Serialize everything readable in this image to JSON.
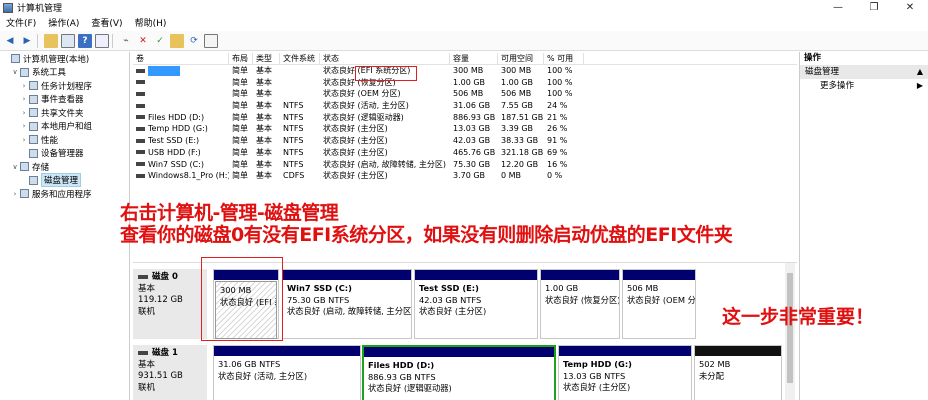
{
  "window": {
    "title": "计算机管理",
    "controls": [
      "—",
      "❐",
      "✕"
    ]
  },
  "menu": [
    "文件(F)",
    "操作(A)",
    "查看(V)",
    "帮助(H)"
  ],
  "tree": {
    "items": [
      {
        "label": "计算机管理(本地)",
        "indent": 0,
        "arrow": ""
      },
      {
        "label": "系统工具",
        "indent": 1,
        "arrow": "∨"
      },
      {
        "label": "任务计划程序",
        "indent": 2,
        "arrow": "›"
      },
      {
        "label": "事件查看器",
        "indent": 2,
        "arrow": "›"
      },
      {
        "label": "共享文件夹",
        "indent": 2,
        "arrow": "›"
      },
      {
        "label": "本地用户和组",
        "indent": 2,
        "arrow": "›"
      },
      {
        "label": "性能",
        "indent": 2,
        "arrow": "›"
      },
      {
        "label": "设备管理器",
        "indent": 2,
        "arrow": ""
      },
      {
        "label": "存储",
        "indent": 1,
        "arrow": "∨"
      },
      {
        "label": "磁盘管理",
        "indent": 2,
        "arrow": "",
        "selected": true
      },
      {
        "label": "服务和应用程序",
        "indent": 1,
        "arrow": "›"
      }
    ]
  },
  "table": {
    "headers": [
      "卷",
      "布局",
      "类型",
      "文件系统",
      "状态",
      "容量",
      "可用空间",
      "% 可用"
    ],
    "rows": [
      {
        "vol": "",
        "layout": "简单",
        "type": "基本",
        "fs": "",
        "status": "状态良好 (EFI 系统分区)",
        "cap": "300 MB",
        "free": "300 MB",
        "pct": "100 %",
        "selected": true
      },
      {
        "vol": "",
        "layout": "简单",
        "type": "基本",
        "fs": "",
        "status": "状态良好 (恢复分区)",
        "cap": "1.00 GB",
        "free": "1.00 GB",
        "pct": "100 %"
      },
      {
        "vol": "",
        "layout": "简单",
        "type": "基本",
        "fs": "",
        "status": "状态良好 (OEM 分区)",
        "cap": "506 MB",
        "free": "506 MB",
        "pct": "100 %"
      },
      {
        "vol": "",
        "layout": "简单",
        "type": "基本",
        "fs": "NTFS",
        "status": "状态良好 (活动, 主分区)",
        "cap": "31.06 GB",
        "free": "7.55 GB",
        "pct": "24 %"
      },
      {
        "vol": "Files HDD (D:)",
        "layout": "简单",
        "type": "基本",
        "fs": "NTFS",
        "status": "状态良好 (逻辑驱动器)",
        "cap": "886.93 GB",
        "free": "187.51 GB",
        "pct": "21 %"
      },
      {
        "vol": "Temp HDD (G:)",
        "layout": "简单",
        "type": "基本",
        "fs": "NTFS",
        "status": "状态良好 (主分区)",
        "cap": "13.03 GB",
        "free": "3.39 GB",
        "pct": "26 %"
      },
      {
        "vol": "Test SSD (E:)",
        "layout": "简单",
        "type": "基本",
        "fs": "NTFS",
        "status": "状态良好 (主分区)",
        "cap": "42.03 GB",
        "free": "38.33 GB",
        "pct": "91 %"
      },
      {
        "vol": "USB HDD (F:)",
        "layout": "简单",
        "type": "基本",
        "fs": "NTFS",
        "status": "状态良好 (主分区)",
        "cap": "465.76 GB",
        "free": "321.18 GB",
        "pct": "69 %"
      },
      {
        "vol": "Win7 SSD (C:)",
        "layout": "简单",
        "type": "基本",
        "fs": "NTFS",
        "status": "状态良好 (启动, 故障转储, 主分区)",
        "cap": "75.30 GB",
        "free": "12.20 GB",
        "pct": "16 %"
      },
      {
        "vol": "Windows8.1_Pro (H:)",
        "layout": "简单",
        "type": "基本",
        "fs": "CDFS",
        "status": "状态良好 (主分区)",
        "cap": "3.70 GB",
        "free": "0 MB",
        "pct": "0 %"
      }
    ]
  },
  "actions": {
    "header": "操作",
    "section": "磁盘管理",
    "more": "更多操作"
  },
  "annotations": {
    "line1": "右击计算机-管理-磁盘管理",
    "line2": "查看你的磁盘0有没有EFI系统分区，如果没有则删除启动优盘的EFI文件夹",
    "line3": "这一步非常重要！",
    "color": "#e01010"
  },
  "disks": [
    {
      "name": "磁盘 0",
      "type": "基本",
      "size": "119.12 GB",
      "state": "联机",
      "partitions": [
        {
          "title": "",
          "size": "300 MB",
          "status": "状态良好 (EFI 系统分区)",
          "hatched": true
        },
        {
          "title": "Win7 SSD  (C:)",
          "size": "75.30 GB NTFS",
          "status": "状态良好 (启动, 故障转储, 主分区)"
        },
        {
          "title": "Test SSD  (E:)",
          "size": "42.03 GB NTFS",
          "status": "状态良好 (主分区)"
        },
        {
          "title": "",
          "size": "1.00 GB",
          "status": "状态良好 (恢复分区)"
        },
        {
          "title": "",
          "size": "506 MB",
          "status": "状态良好 (OEM 分区)"
        }
      ]
    },
    {
      "name": "磁盘 1",
      "type": "基本",
      "size": "931.51 GB",
      "state": "联机",
      "partitions": [
        {
          "title": "",
          "size": "31.06 GB NTFS",
          "status": "状态良好 (活动, 主分区)"
        },
        {
          "title": "Files HDD  (D:)",
          "size": "886.93 GB NTFS",
          "status": "状态良好 (逻辑驱动器)",
          "green": true
        },
        {
          "title": "Temp HDD  (G:)",
          "size": "13.03 GB NTFS",
          "status": "状态良好 (主分区)"
        },
        {
          "title": "",
          "size": "502 MB",
          "status": "未分配"
        }
      ]
    }
  ]
}
